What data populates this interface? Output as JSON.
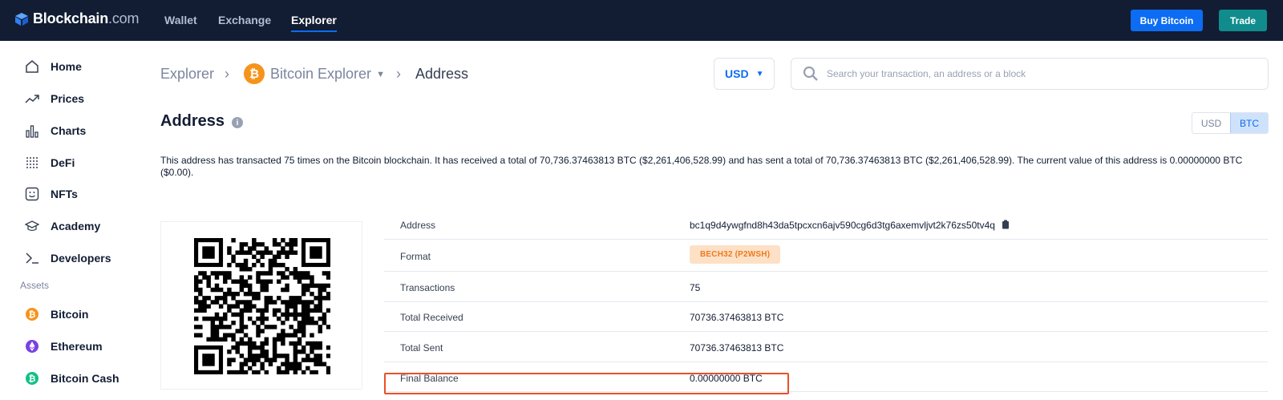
{
  "brand": {
    "name": "Blockchain",
    "suffix": ".com"
  },
  "nav": {
    "wallet": "Wallet",
    "exchange": "Exchange",
    "explorer": "Explorer"
  },
  "actions": {
    "buy": "Buy Bitcoin",
    "trade": "Trade"
  },
  "sidebar": {
    "items": [
      {
        "label": "Home",
        "icon": "home-icon"
      },
      {
        "label": "Prices",
        "icon": "trend-icon"
      },
      {
        "label": "Charts",
        "icon": "bar-chart-icon"
      },
      {
        "label": "DeFi",
        "icon": "grid-dots-icon"
      },
      {
        "label": "NFTs",
        "icon": "smile-icon"
      },
      {
        "label": "Academy",
        "icon": "graduation-cap-icon"
      },
      {
        "label": "Developers",
        "icon": "terminal-icon"
      }
    ],
    "section": "Assets",
    "assets": [
      {
        "label": "Bitcoin",
        "icon": "bitcoin-icon",
        "color": "#f7931a"
      },
      {
        "label": "Ethereum",
        "icon": "ethereum-icon",
        "color": "#7b3fe4"
      },
      {
        "label": "Bitcoin Cash",
        "icon": "bitcoin-cash-icon",
        "color": "#10c085"
      }
    ]
  },
  "breadcrumb": {
    "root": "Explorer",
    "middle": "Bitcoin Explorer",
    "current": "Address"
  },
  "currency": {
    "selected": "USD"
  },
  "search": {
    "placeholder": "Search your transaction, an address or a block"
  },
  "page": {
    "title": "Address"
  },
  "toggle": {
    "usd": "USD",
    "btc": "BTC",
    "active": "BTC"
  },
  "description": "This address has transacted 75 times on the Bitcoin blockchain. It has received a total of 70,736.37463813 BTC ($2,261,406,528.99) and has sent a total of 70,736.37463813 BTC ($2,261,406,528.99). The current value of this address is 0.00000000 BTC ($0.00).",
  "details": {
    "address_label": "Address",
    "address": "bc1q9d4ywgfnd8h43da5tpcxcn6ajv590cg6d3tg6axemvljvt2k76zs50tv4q",
    "format_label": "Format",
    "format": "BECH32 (P2WSH)",
    "transactions_label": "Transactions",
    "transactions": "75",
    "received_label": "Total Received",
    "received": "70736.37463813 BTC",
    "sent_label": "Total Sent",
    "sent": "70736.37463813 BTC",
    "balance_label": "Final Balance",
    "balance": "0.00000000 BTC"
  },
  "colors": {
    "nav_bg": "#121d33",
    "accent": "#0c6cf2",
    "trade": "#108c8c",
    "bitcoin": "#f7931a",
    "highlight": "#e8502a"
  }
}
